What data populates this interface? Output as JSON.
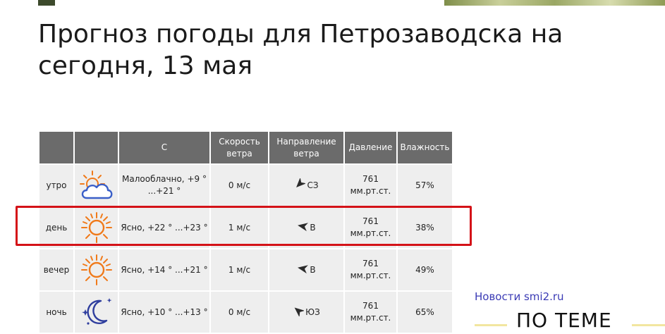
{
  "title": "Прогноз погоды для Петрозаводска на сегодня, 13 мая",
  "table": {
    "headers": {
      "time": "",
      "icon": "",
      "condition": "С",
      "speed": "Скорость ветра",
      "direction": "Направление ветра",
      "pressure": "Давление",
      "humidity": "Влажность"
    },
    "rows": [
      {
        "time": "утро",
        "icon": "partly-cloudy-icon",
        "condition": "Малооблачно, +9 ° ...+21 °",
        "speed": "0 м/с",
        "direction": "СЗ",
        "pressure": "761 мм.рт.ст.",
        "humidity": "57%"
      },
      {
        "time": "день",
        "icon": "sun-icon",
        "condition": "Ясно, +22 ° ...+23 °",
        "speed": "1 м/с",
        "direction": "В",
        "pressure": "761 мм.рт.ст.",
        "humidity": "38%"
      },
      {
        "time": "вечер",
        "icon": "sun-icon",
        "condition": "Ясно, +14 ° ...+21 °",
        "speed": "1 м/с",
        "direction": "В",
        "pressure": "761 мм.рт.ст.",
        "humidity": "49%"
      },
      {
        "time": "ночь",
        "icon": "moon-stars-icon",
        "condition": "Ясно, +10 ° ...+13 °",
        "speed": "0 м/с",
        "direction": "ЮЗ",
        "pressure": "761 мм.рт.ст.",
        "humidity": "65%"
      }
    ]
  },
  "sidebar": {
    "news_link": "Новости smi2.ru",
    "heading": "ПО ТЕМЕ"
  },
  "colors": {
    "header_bg": "#6b6b6b",
    "cell_bg": "#eeeeee",
    "highlight": "#d41218",
    "sun": "#f07a1a",
    "cloud": "#3a5fc8",
    "moon": "#2f3e9e",
    "link": "#3b3bb5"
  }
}
